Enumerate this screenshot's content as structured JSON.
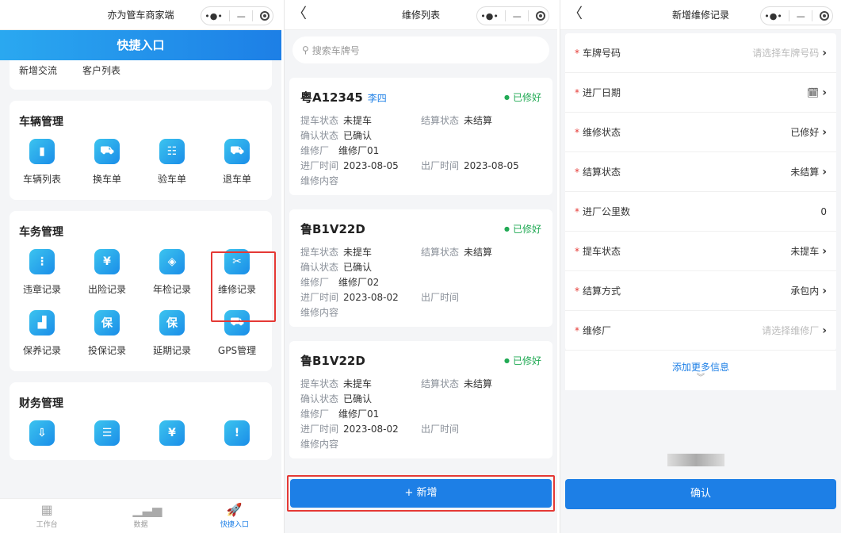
{
  "panel1": {
    "title": "亦为管车商家端",
    "banner": "快捷入口",
    "top_items": [
      "新增交流",
      "客户列表"
    ],
    "sections": [
      {
        "title": "车辆管理",
        "items": [
          {
            "label": "车辆列表",
            "icon": "car-list-icon",
            "glyph": "▮"
          },
          {
            "label": "换车单",
            "icon": "car-swap-icon",
            "glyph": "⛟"
          },
          {
            "label": "验车单",
            "icon": "inspect-icon",
            "glyph": "☷"
          },
          {
            "label": "退车单",
            "icon": "car-return-icon",
            "glyph": "⛟"
          }
        ]
      },
      {
        "title": "车务管理",
        "items": [
          {
            "label": "违章记录",
            "icon": "traffic-light-icon",
            "glyph": "⋮"
          },
          {
            "label": "出险记录",
            "icon": "claim-icon",
            "glyph": "¥"
          },
          {
            "label": "年检记录",
            "icon": "shield-icon",
            "glyph": "◈"
          },
          {
            "label": "维修记录",
            "icon": "tools-icon",
            "glyph": "✂"
          },
          {
            "label": "保养记录",
            "icon": "oil-icon",
            "glyph": "▟"
          },
          {
            "label": "投保记录",
            "icon": "insure-icon",
            "glyph": "保"
          },
          {
            "label": "延期记录",
            "icon": "extend-icon",
            "glyph": "保"
          },
          {
            "label": "GPS管理",
            "icon": "gps-car-icon",
            "glyph": "⛟"
          }
        ]
      },
      {
        "title": "财务管理",
        "items": [
          {
            "label": "",
            "icon": "finance-down-icon",
            "glyph": "⇩"
          },
          {
            "label": "",
            "icon": "bill-icon",
            "glyph": "☰"
          },
          {
            "label": "",
            "icon": "ledger-icon",
            "glyph": "¥"
          },
          {
            "label": "",
            "icon": "alert-icon",
            "glyph": "!"
          }
        ]
      }
    ],
    "tabs": [
      {
        "label": "工作台",
        "glyph": "▦",
        "icon": "workbench-icon"
      },
      {
        "label": "数据",
        "glyph": "▁▃▅",
        "icon": "chart-icon"
      },
      {
        "label": "快捷入口",
        "glyph": "🚀",
        "icon": "rocket-icon"
      }
    ]
  },
  "panel2": {
    "title": "维修列表",
    "search_placeholder": "搜索车牌号",
    "records": [
      {
        "plate": "粤A12345",
        "owner": "李四",
        "status": "已修好",
        "pickup_label": "提车状态",
        "pickup": "未提车",
        "settle_label": "结算状态",
        "settle": "未结算",
        "confirm_label": "确认状态",
        "confirm": "已确认",
        "shop_label": "维修厂",
        "shop": "维修厂01",
        "in_label": "进厂时间",
        "in_time": "2023-08-05",
        "out_label": "出厂时间",
        "out_time": "2023-08-05",
        "content_label": "维修内容"
      },
      {
        "plate": "鲁B1V22D",
        "owner": "",
        "status": "已修好",
        "pickup_label": "提车状态",
        "pickup": "未提车",
        "settle_label": "结算状态",
        "settle": "未结算",
        "confirm_label": "确认状态",
        "confirm": "已确认",
        "shop_label": "维修厂",
        "shop": "维修厂02",
        "in_label": "进厂时间",
        "in_time": "2023-08-02",
        "out_label": "出厂时间",
        "out_time": "",
        "content_label": "维修内容"
      },
      {
        "plate": "鲁B1V22D",
        "owner": "",
        "status": "已修好",
        "pickup_label": "提车状态",
        "pickup": "未提车",
        "settle_label": "结算状态",
        "settle": "未结算",
        "confirm_label": "确认状态",
        "confirm": "已确认",
        "shop_label": "维修厂",
        "shop": "维修厂01",
        "in_label": "进厂时间",
        "in_time": "2023-08-02",
        "out_label": "出厂时间",
        "out_time": "",
        "content_label": "维修内容"
      }
    ],
    "add_button": "+ 新增"
  },
  "panel3": {
    "title": "新增维修记录",
    "fields": [
      {
        "label": "车牌号码",
        "value": "请选择车牌号码",
        "placeholder": true,
        "chevron": true
      },
      {
        "label": "进厂日期",
        "value": "🗓",
        "placeholder": false,
        "chevron": true
      },
      {
        "label": "维修状态",
        "value": "已修好",
        "placeholder": false,
        "chevron": true
      },
      {
        "label": "结算状态",
        "value": "未结算",
        "placeholder": false,
        "chevron": true
      },
      {
        "label": "进厂公里数",
        "value": "0",
        "placeholder": false,
        "chevron": false
      },
      {
        "label": "提车状态",
        "value": "未提车",
        "placeholder": false,
        "chevron": true
      },
      {
        "label": "结算方式",
        "value": "承包内",
        "placeholder": false,
        "chevron": true
      },
      {
        "label": "维修厂",
        "value": "请选择维修厂",
        "placeholder": true,
        "chevron": true
      }
    ],
    "more_info": "添加更多信息",
    "confirm_button": "确认"
  },
  "colors": {
    "accent": "#1d7fe6",
    "success": "#22aa55",
    "highlight": "#e53935"
  }
}
